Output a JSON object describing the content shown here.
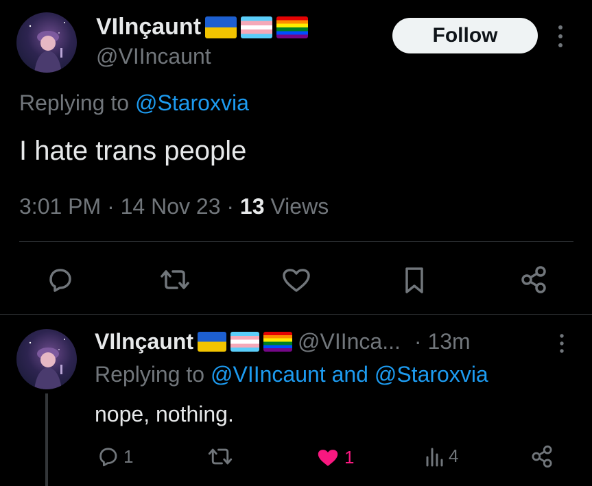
{
  "tweet": {
    "author_name": "VIlnçaunt",
    "author_handle": "@VIIncaunt",
    "follow_label": "Follow",
    "reply_prefix": "Replying to ",
    "reply_target": "@Staroxvia",
    "body": "I hate trans people",
    "time": "3:01 PM",
    "dot1": " · ",
    "date": "14 Nov 23",
    "dot2": " · ",
    "views_count": "13",
    "views_label": " Views"
  },
  "reply": {
    "author_name": "VIlnçaunt",
    "author_handle": "@VIInca...",
    "time": "· 13m",
    "reply_prefix": "Replying to ",
    "reply_targets": "@VIIncaunt and @Staroxvia",
    "body": "nope, nothing.",
    "replies_count": "1",
    "likes_count": "1",
    "views_count": "4"
  },
  "icons": {
    "flags": [
      "ukraine-flag",
      "transgender-flag",
      "pride-flag"
    ],
    "actions": [
      "reply-icon",
      "retweet-icon",
      "like-icon",
      "bookmark-icon",
      "share-icon"
    ]
  },
  "colors": {
    "background": "#000000",
    "link": "#1d9bf0",
    "like_active": "#f91880",
    "muted": "#71767b"
  }
}
